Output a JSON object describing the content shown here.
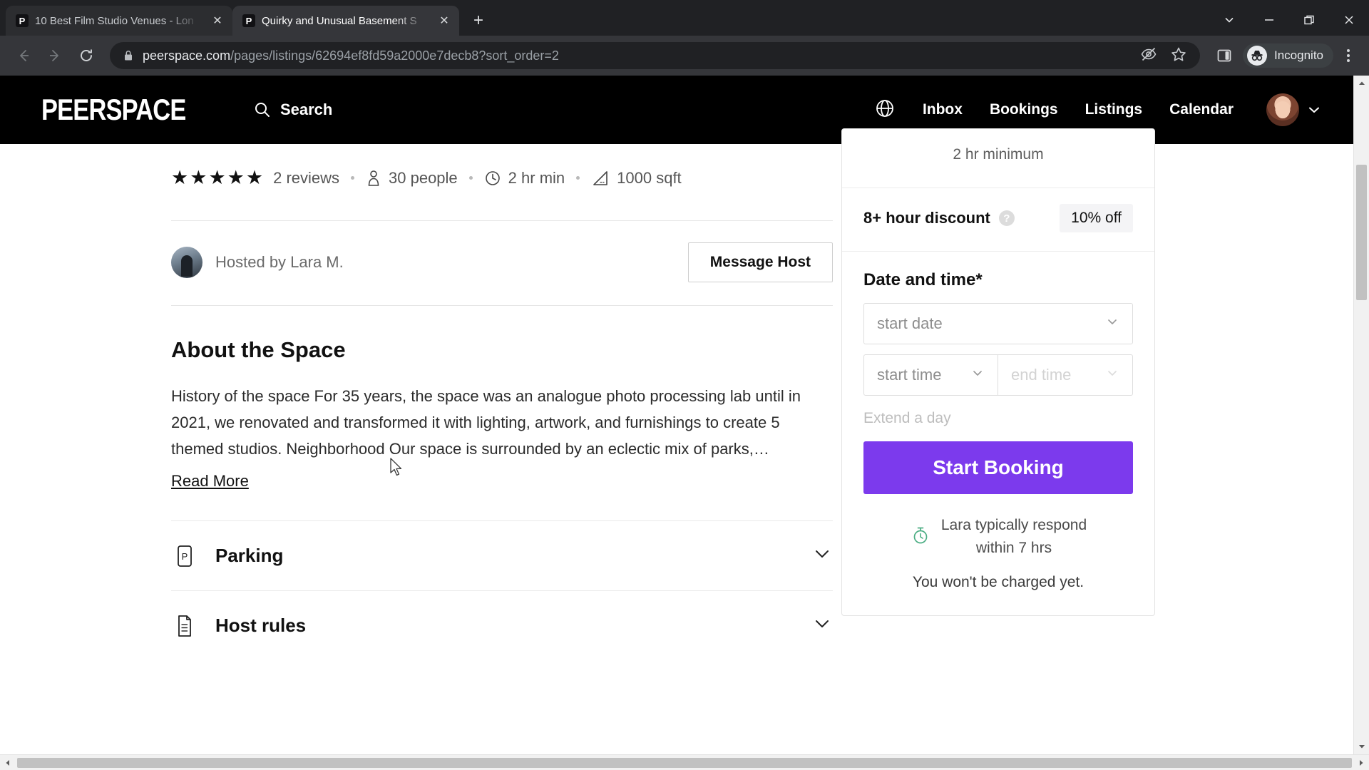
{
  "browser": {
    "tabs": [
      {
        "title": "10 Best Film Studio Venues - Lon",
        "favicon": "peerspace-p-icon",
        "active": false,
        "close_label": "✕"
      },
      {
        "title": "Quirky and Unusual Basement S",
        "favicon": "peerspace-p-icon",
        "active": true,
        "close_label": "✕"
      }
    ],
    "new_tab_label": "+",
    "window_controls": {
      "tab_search": "tab-search-chevron-icon",
      "minimize": "minimize-icon",
      "maximize": "restore-icon",
      "close": "close-icon"
    },
    "toolbar": {
      "back": "back-arrow-icon",
      "forward": "forward-arrow-icon",
      "reload": "reload-icon",
      "lock": "lock-icon",
      "url_domain": "peerspace.com",
      "url_path": "/pages/listings/62694ef8fd59a2000e7decb8?sort_order=2",
      "url_full": "peerspace.com/pages/listings/62694ef8fd59a2000e7decb8?sort_order=2",
      "tracking_icon": "eye-crossed-icon",
      "bookmark_icon": "star-icon",
      "side_panel_icon": "side-panel-icon",
      "incognito_label": "Incognito",
      "menu_icon": "kebab-menu-icon"
    }
  },
  "site_header": {
    "logo": "PEERSPACE",
    "search_label": "Search",
    "globe_icon": "globe-icon",
    "nav": [
      {
        "label": "Inbox"
      },
      {
        "label": "Bookings"
      },
      {
        "label": "Listings"
      },
      {
        "label": "Calendar"
      }
    ],
    "account_chevron": "chevron-down-icon"
  },
  "listing": {
    "rating_stars": 5,
    "reviews": "2 reviews",
    "capacity": "30 people",
    "minimum": "2 hr min",
    "size": "1000 sqft",
    "host_label": "Hosted by Lara M.",
    "message_host": "Message Host",
    "about_heading": "About the Space",
    "about_text": "History of the space For 35 years, the space was an analogue photo processing lab until in 2021, we renovated and transformed it with lighting, artwork, and furnishings to create 5 themed studios. Neighborhood Our space is surrounded by an eclectic mix of parks,…",
    "read_more": "Read More",
    "sections": [
      {
        "label": "Parking",
        "icon": "parking-icon"
      },
      {
        "label": "Host rules",
        "icon": "document-icon"
      }
    ]
  },
  "booking": {
    "minimum_note": "2 hr minimum",
    "discount_label": "8+ hour discount",
    "discount_help": "?",
    "discount_value": "10% off",
    "date_time_heading": "Date and time*",
    "start_date_placeholder": "start date",
    "start_time_placeholder": "start time",
    "end_time_placeholder": "end time",
    "extend_label": "Extend a day",
    "start_booking": "Start Booking",
    "response_line1": "Lara typically respond",
    "response_line2": "within 7 hrs",
    "no_charge": "You won't be charged yet.",
    "accent_color": "#7c3aed",
    "response_icon": "stopwatch-icon"
  }
}
